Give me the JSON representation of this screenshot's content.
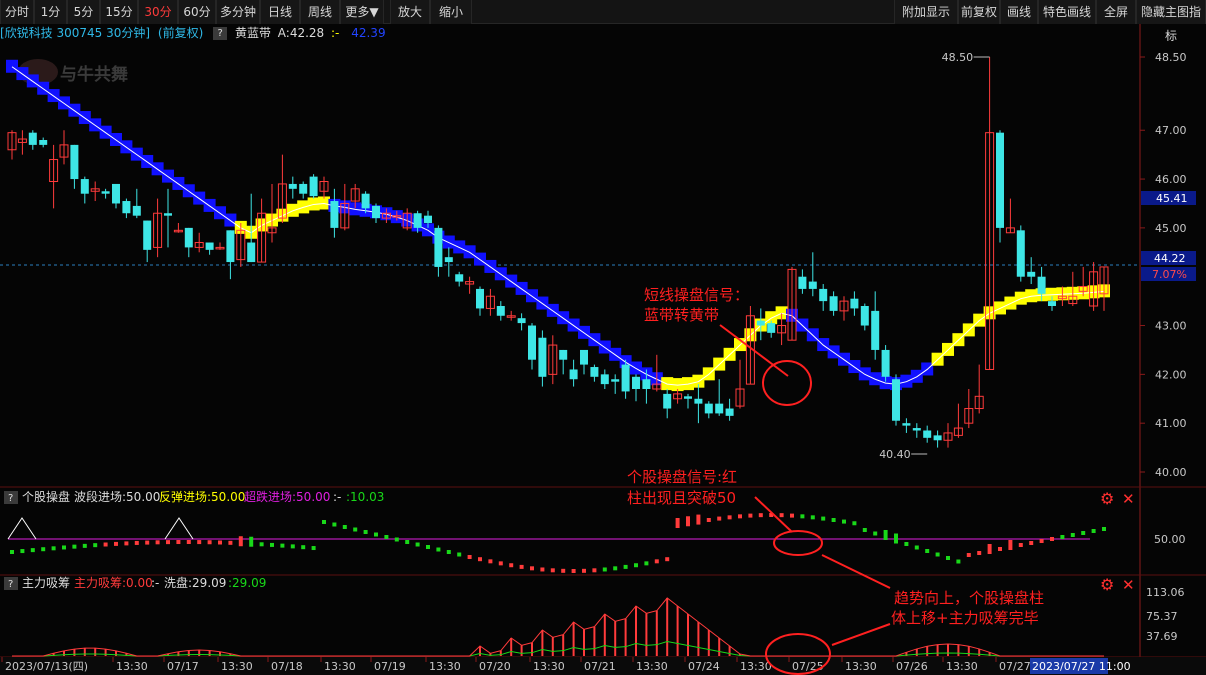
{
  "toolbar": {
    "left": [
      "分时",
      "1分",
      "5分",
      "15分",
      "30分",
      "60分",
      "多分钟",
      "日线",
      "周线",
      "更多▼",
      "放大",
      "缩小"
    ],
    "right": [
      "附加显示",
      "前复权",
      "画线",
      "特色画线",
      "全屏",
      "隐藏主图指标"
    ],
    "active": "30分"
  },
  "main_info": {
    "stock": "[欣锐科技 300745 30分钟]",
    "adj": "(前复权)",
    "q": "?",
    "indicator": "黄蓝带",
    "value_label": "A:42.28",
    "sep": ":-",
    "value2": "42.39"
  },
  "watermark": "与牛共舞",
  "colors": {
    "up": "#ff3b3b",
    "down": "#3ee6e6",
    "blue": "#1010ff",
    "yellow": "#ffff00",
    "green": "#19d819",
    "magenta": "#e020e0"
  },
  "chart_data": [
    {
      "type": "candlestick",
      "name": "main",
      "yaxis_ticks": [
        "48.50",
        "47.00",
        "46.00",
        "45.00",
        "43.00",
        "42.00",
        "41.00",
        "40.00"
      ],
      "ylim": [
        39.8,
        48.85
      ],
      "high_marker": "48.50",
      "low_marker": "40.40",
      "last_price": "44.22",
      "last_change": "7.07%",
      "mark_price": "45.41",
      "candles": [
        [
          46.6,
          46.95,
          47.0,
          46.4
        ],
        [
          46.75,
          46.82,
          47.0,
          46.5
        ],
        [
          46.95,
          46.7,
          47.0,
          46.6
        ],
        [
          46.8,
          46.7,
          46.85,
          46.65
        ],
        [
          45.95,
          46.4,
          46.7,
          45.4
        ],
        [
          46.45,
          46.7,
          47.0,
          46.3
        ],
        [
          46.7,
          46.0,
          46.7,
          45.8
        ],
        [
          46.0,
          45.7,
          46.05,
          45.5
        ],
        [
          45.75,
          45.8,
          45.95,
          45.55
        ],
        [
          45.75,
          45.7,
          45.8,
          45.6
        ],
        [
          45.9,
          45.5,
          45.9,
          45.4
        ],
        [
          45.55,
          45.3,
          45.6,
          45.2
        ],
        [
          45.45,
          45.25,
          45.8,
          45.2
        ],
        [
          45.15,
          44.55,
          45.15,
          44.3
        ],
        [
          44.6,
          45.3,
          45.6,
          44.4
        ],
        [
          45.3,
          45.25,
          45.8,
          44.6
        ],
        [
          44.95,
          44.95,
          45.1,
          44.9
        ],
        [
          45.0,
          44.6,
          45.0,
          44.4
        ],
        [
          44.6,
          44.7,
          44.9,
          44.5
        ],
        [
          44.7,
          44.55,
          44.7,
          44.45
        ],
        [
          44.6,
          44.6,
          44.7,
          44.55
        ],
        [
          44.95,
          44.3,
          44.95,
          43.95
        ],
        [
          44.35,
          44.95,
          45.1,
          44.2
        ],
        [
          44.7,
          44.3,
          45.7,
          44.3
        ],
        [
          44.3,
          45.3,
          45.6,
          44.3
        ],
        [
          44.9,
          45.0,
          45.9,
          44.7
        ],
        [
          45.2,
          45.9,
          46.5,
          45.1
        ],
        [
          45.9,
          45.8,
          46.05,
          45.6
        ],
        [
          45.9,
          45.7,
          45.95,
          45.6
        ],
        [
          46.05,
          45.65,
          46.1,
          45.6
        ],
        [
          45.75,
          45.95,
          46.05,
          45.6
        ],
        [
          45.55,
          45.0,
          45.8,
          44.8
        ],
        [
          45.0,
          45.5,
          45.9,
          44.95
        ],
        [
          45.55,
          45.8,
          45.9,
          45.4
        ],
        [
          45.7,
          45.4,
          45.75,
          45.3
        ],
        [
          45.45,
          45.2,
          45.5,
          45.1
        ],
        [
          45.2,
          45.3,
          45.4,
          45.1
        ],
        [
          45.25,
          45.25,
          45.35,
          45.15
        ],
        [
          45.0,
          45.3,
          45.4,
          44.95
        ],
        [
          45.3,
          45.0,
          45.35,
          44.9
        ],
        [
          45.25,
          45.1,
          45.35,
          45.0
        ],
        [
          45.0,
          44.2,
          45.05,
          44.0
        ],
        [
          44.4,
          44.3,
          44.6,
          44.0
        ],
        [
          44.05,
          43.9,
          44.1,
          43.8
        ],
        [
          43.85,
          43.9,
          44.0,
          43.65
        ],
        [
          43.75,
          43.35,
          43.8,
          43.2
        ],
        [
          43.35,
          43.6,
          43.75,
          43.2
        ],
        [
          43.4,
          43.2,
          43.5,
          43.1
        ],
        [
          43.2,
          43.2,
          43.3,
          43.1
        ],
        [
          43.15,
          43.05,
          43.25,
          42.9
        ],
        [
          43.0,
          42.3,
          43.05,
          42.1
        ],
        [
          42.75,
          41.95,
          42.9,
          41.75
        ],
        [
          42.0,
          42.6,
          42.8,
          41.8
        ],
        [
          42.5,
          42.3,
          42.5,
          42.0
        ],
        [
          42.1,
          41.9,
          42.3,
          41.75
        ],
        [
          42.5,
          42.2,
          42.5,
          42.0
        ],
        [
          42.15,
          41.95,
          42.2,
          41.85
        ],
        [
          42.0,
          41.8,
          42.1,
          41.7
        ],
        [
          41.9,
          41.85,
          42.0,
          41.6
        ],
        [
          42.2,
          41.65,
          42.3,
          41.5
        ],
        [
          41.95,
          41.7,
          42.0,
          41.45
        ],
        [
          41.9,
          41.7,
          42.1,
          41.4
        ],
        [
          41.7,
          41.8,
          42.4,
          41.65
        ],
        [
          41.6,
          41.3,
          41.7,
          41.1
        ],
        [
          41.5,
          41.6,
          41.7,
          41.4
        ],
        [
          41.55,
          41.5,
          41.6,
          41.3
        ],
        [
          41.5,
          41.4,
          41.8,
          41.0
        ],
        [
          41.4,
          41.2,
          41.45,
          41.1
        ],
        [
          41.4,
          41.2,
          41.9,
          41.15
        ],
        [
          41.3,
          41.15,
          41.5,
          41.05
        ],
        [
          41.35,
          41.7,
          42.3,
          41.3
        ],
        [
          41.8,
          43.2,
          43.4,
          41.8
        ],
        [
          43.1,
          43.0,
          43.35,
          42.7
        ],
        [
          43.05,
          42.85,
          43.1,
          42.75
        ],
        [
          42.85,
          43.0,
          43.25,
          42.6
        ],
        [
          42.7,
          44.15,
          44.2,
          42.7
        ],
        [
          44.0,
          43.75,
          44.15,
          43.65
        ],
        [
          43.9,
          43.75,
          44.5,
          43.6
        ],
        [
          43.75,
          43.5,
          43.85,
          43.3
        ],
        [
          43.6,
          43.3,
          43.7,
          43.2
        ],
        [
          43.3,
          43.5,
          43.6,
          43.1
        ],
        [
          43.55,
          43.35,
          43.7,
          43.2
        ],
        [
          43.4,
          43.0,
          43.45,
          42.9
        ],
        [
          43.3,
          42.5,
          43.7,
          42.3
        ],
        [
          42.5,
          41.95,
          42.6,
          41.85
        ],
        [
          41.9,
          41.05,
          42.0,
          40.95
        ],
        [
          41.0,
          40.95,
          41.1,
          40.8
        ],
        [
          40.9,
          40.85,
          41.0,
          40.7
        ],
        [
          40.85,
          40.7,
          40.95,
          40.6
        ],
        [
          40.75,
          40.65,
          40.85,
          40.5
        ],
        [
          40.65,
          40.8,
          41.0,
          40.5
        ],
        [
          40.75,
          40.9,
          41.4,
          40.7
        ],
        [
          41.0,
          41.3,
          41.7,
          40.9
        ],
        [
          41.3,
          41.55,
          42.2,
          41.2
        ],
        [
          42.1,
          46.95,
          48.5,
          42.1
        ],
        [
          46.95,
          45.0,
          47.0,
          44.7
        ],
        [
          44.9,
          45.0,
          45.6,
          44.9
        ],
        [
          44.95,
          44.0,
          45.05,
          43.9
        ],
        [
          44.1,
          44.0,
          44.4,
          43.85
        ],
        [
          44.0,
          43.65,
          44.2,
          43.5
        ],
        [
          43.5,
          43.4,
          43.6,
          43.3
        ],
        [
          43.55,
          43.6,
          43.8,
          43.4
        ],
        [
          43.45,
          43.6,
          44.1,
          43.4
        ],
        [
          43.7,
          43.8,
          44.2,
          43.6
        ],
        [
          43.4,
          44.1,
          44.3,
          43.3
        ],
        [
          43.65,
          44.2,
          44.2,
          43.3
        ]
      ],
      "band": [
        48.3,
        48.15,
        48.0,
        47.85,
        47.7,
        47.55,
        47.4,
        47.25,
        47.1,
        46.95,
        46.8,
        46.65,
        46.5,
        46.35,
        46.2,
        46.05,
        45.9,
        45.75,
        45.6,
        45.45,
        45.3,
        45.15,
        45.0,
        44.9,
        45.05,
        45.15,
        45.25,
        45.35,
        45.42,
        45.48,
        45.5,
        45.45,
        45.42,
        45.38,
        45.35,
        45.32,
        45.28,
        45.22,
        45.15,
        45.05,
        44.95,
        44.8,
        44.7,
        44.6,
        44.5,
        44.35,
        44.2,
        44.05,
        43.9,
        43.75,
        43.6,
        43.45,
        43.3,
        43.15,
        43.0,
        42.85,
        42.7,
        42.55,
        42.4,
        42.25,
        42.12,
        42.0,
        41.9,
        41.8,
        41.78,
        41.8,
        41.85,
        42.0,
        42.2,
        42.4,
        42.6,
        42.8,
        43.0,
        43.15,
        43.25,
        43.2,
        43.0,
        42.8,
        42.6,
        42.45,
        42.3,
        42.15,
        42.0,
        41.9,
        41.82,
        41.8,
        41.85,
        41.95,
        42.1,
        42.3,
        42.5,
        42.7,
        42.9,
        43.1,
        43.25,
        43.35,
        43.45,
        43.55,
        43.6,
        43.62,
        43.63,
        43.64,
        43.65,
        43.66,
        43.68,
        43.7
      ],
      "annotations": [
        "短线操盘信号：",
        "蓝带转黄带"
      ]
    },
    {
      "type": "bar",
      "name": "个股操盘",
      "labels": {
        "q": "?",
        "name": "个股操盘",
        "s1": "波段进场:50.00",
        "s2": "反弹进场:50.00",
        "s3": "超跌进场:50.00",
        "s4": ":-",
        "s5": ":10.03"
      },
      "yaxis_ticks": [
        "50.00"
      ],
      "reference_line": 50,
      "annotations": [
        "个股操盘信号:红",
        "柱出现且突破50"
      ]
    },
    {
      "type": "bar",
      "name": "主力吸筹",
      "labels": {
        "q": "?",
        "name": "主力吸筹",
        "s1": "主力吸筹:0.00",
        "s2": ":-",
        "s3": "洗盘:29.09",
        "s4": ":29.09"
      },
      "yaxis_ticks": [
        "113.06",
        "75.37",
        "37.69"
      ],
      "annotations": [
        "趋势向上，个股操盘柱",
        "体上移+主力吸筹完毕"
      ]
    }
  ],
  "xaxis": [
    "2023/07/13(四)",
    "13:30",
    "07/17",
    "13:30",
    "07/18",
    "13:30",
    "07/19",
    "13:30",
    "07/20",
    "13:30",
    "07/21",
    "13:30",
    "07/24",
    "13:30",
    "07/25",
    "13:30",
    "07/26",
    "13:30",
    "07/27",
    "2023/07/27 11:00"
  ]
}
